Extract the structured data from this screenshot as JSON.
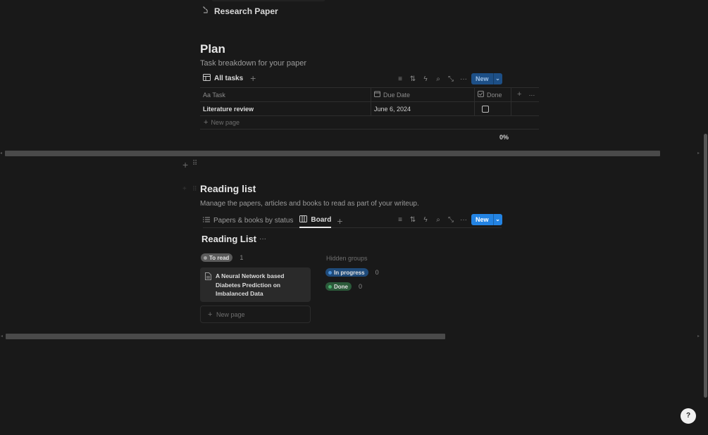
{
  "top_page_link": {
    "icon": "microscope-icon",
    "label": "Research Paper"
  },
  "plan": {
    "title": "Plan",
    "description": "Task breakdown for your paper",
    "view_tab": "All tasks",
    "new_button": "New",
    "columns": [
      "Aa Task",
      "Due Date",
      "Done"
    ],
    "rows": [
      {
        "task": "Literature review",
        "due_date": "June 6, 2024",
        "done": false
      }
    ],
    "new_page": "New page",
    "progress": "0%"
  },
  "reading_list": {
    "title": "Reading list",
    "description": "Manage the papers, articles and books to read as part of your writeup.",
    "tabs": [
      "Papers & books by status",
      "Board"
    ],
    "active_tab": "Board",
    "new_button": "New",
    "board_title": "Reading List",
    "groups": [
      {
        "label": "To read",
        "count": "1",
        "color": "#5a5a5a",
        "dot": "#a0a0a0"
      }
    ],
    "card_title": "A Neural Network based Diabetes Prediction on Imbalanced Data",
    "new_page": "New page",
    "hidden_groups_label": "Hidden groups",
    "hidden_groups": [
      {
        "label": "In progress",
        "count": "0",
        "color": "#1f4b7a",
        "dot": "#4a90d9"
      },
      {
        "label": "Done",
        "count": "0",
        "color": "#2b5a3a",
        "dot": "#4caf6e"
      }
    ]
  },
  "colors": {
    "accent": "#2383e2",
    "background": "#191919"
  },
  "help_button": "?"
}
